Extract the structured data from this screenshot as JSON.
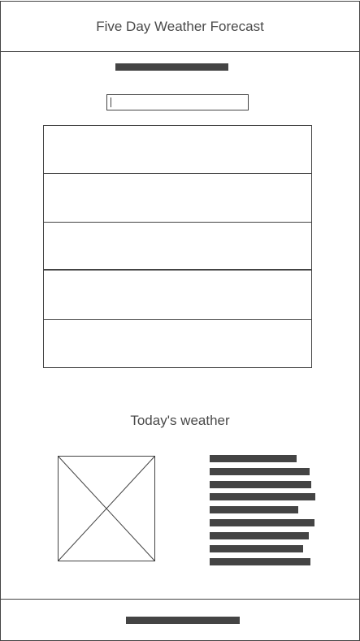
{
  "header": {
    "title": "Five Day Weather Forecast"
  },
  "search": {
    "value": "",
    "placeholder": ""
  },
  "forecast": {
    "days": [
      "",
      "",
      "",
      "",
      ""
    ]
  },
  "today": {
    "title": "Today's weather"
  }
}
